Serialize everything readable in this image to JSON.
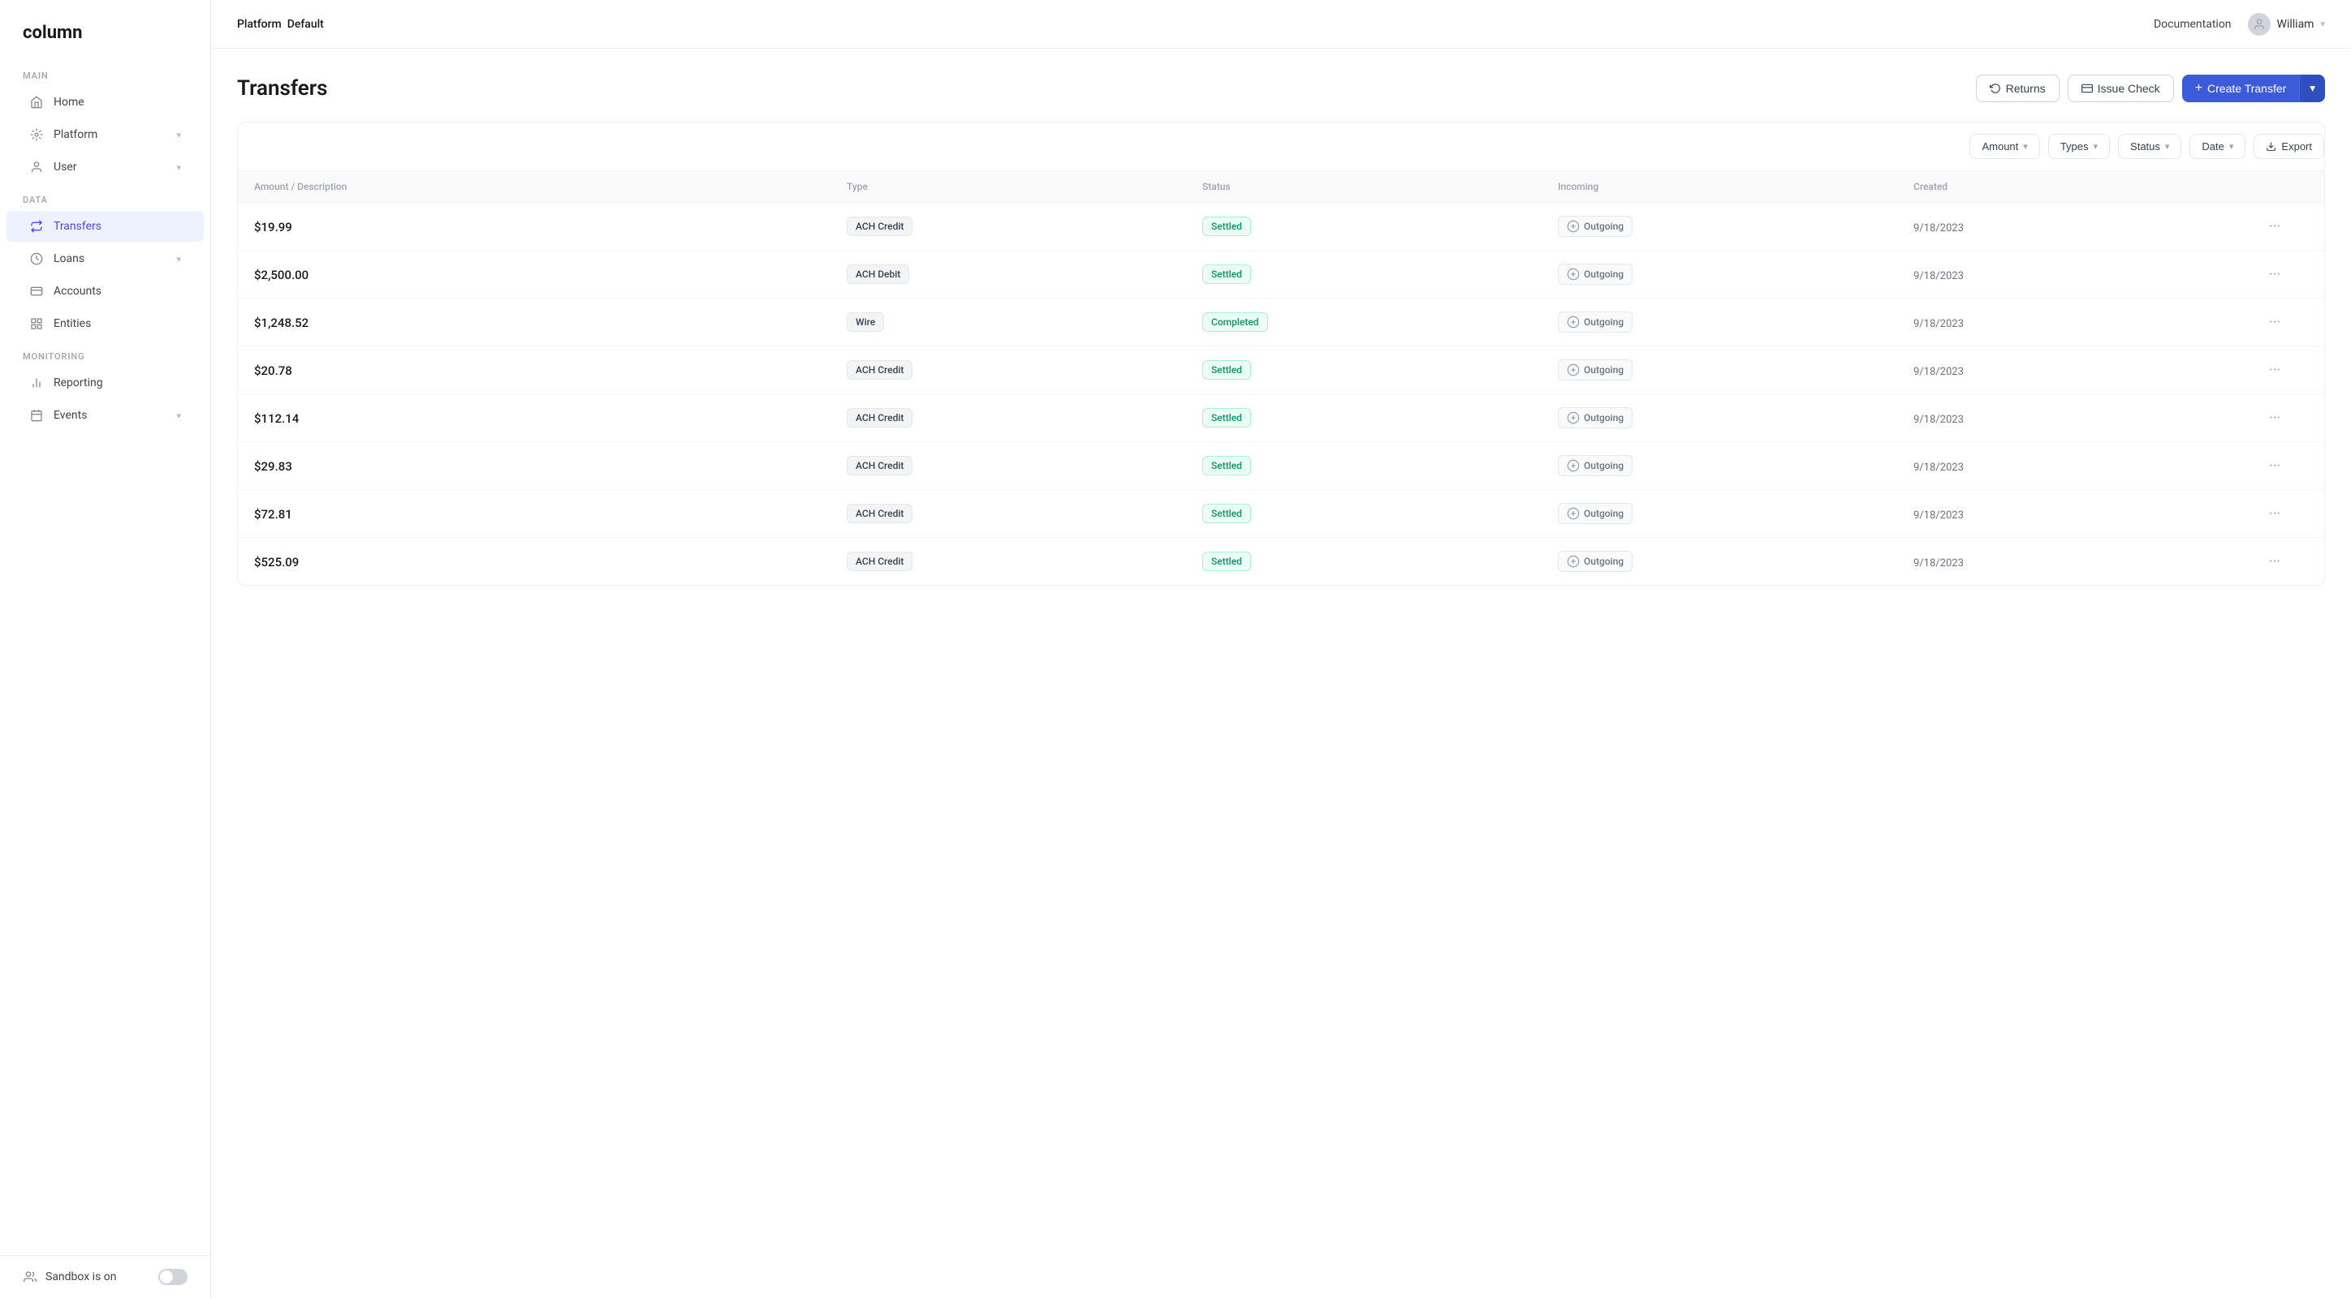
{
  "sidebar": {
    "logo": "column",
    "sections": [
      {
        "label": "MAIN",
        "items": [
          {
            "id": "home",
            "label": "Home",
            "icon": "home",
            "active": false,
            "hasChevron": false
          },
          {
            "id": "platform",
            "label": "Platform",
            "icon": "platform",
            "active": false,
            "hasChevron": true
          },
          {
            "id": "user",
            "label": "User",
            "icon": "user",
            "active": false,
            "hasChevron": true
          }
        ]
      },
      {
        "label": "DATA",
        "items": [
          {
            "id": "transfers",
            "label": "Transfers",
            "icon": "transfers",
            "active": true,
            "hasChevron": false
          },
          {
            "id": "loans",
            "label": "Loans",
            "icon": "loans",
            "active": false,
            "hasChevron": true
          },
          {
            "id": "accounts",
            "label": "Accounts",
            "icon": "accounts",
            "active": false,
            "hasChevron": false
          },
          {
            "id": "entities",
            "label": "Entities",
            "icon": "entities",
            "active": false,
            "hasChevron": false
          }
        ]
      },
      {
        "label": "MONITORING",
        "items": [
          {
            "id": "reporting",
            "label": "Reporting",
            "icon": "reporting",
            "active": false,
            "hasChevron": false
          },
          {
            "id": "events",
            "label": "Events",
            "icon": "events",
            "active": false,
            "hasChevron": true
          }
        ]
      }
    ],
    "sandbox_label": "Sandbox is on"
  },
  "topbar": {
    "platform_label": "Platform",
    "platform_value": "Default",
    "docs_label": "Documentation",
    "user_name": "William"
  },
  "page": {
    "title": "Transfers",
    "returns_btn": "Returns",
    "issue_check_btn": "Issue Check",
    "create_transfer_btn": "+ Create Transfer"
  },
  "filters": {
    "amount_label": "Amount",
    "types_label": "Types",
    "status_label": "Status",
    "date_label": "Date",
    "export_label": "Export"
  },
  "table": {
    "columns": [
      "Amount / Description",
      "Type",
      "Status",
      "Incoming",
      "Created",
      ""
    ],
    "rows": [
      {
        "amount": "$19.99",
        "type": "ACH Credit",
        "status": "Settled",
        "incoming": "Outgoing",
        "created": "9/18/2023"
      },
      {
        "amount": "$2,500.00",
        "type": "ACH Debit",
        "status": "Settled",
        "incoming": "Outgoing",
        "created": "9/18/2023"
      },
      {
        "amount": "$1,248.52",
        "type": "Wire",
        "status": "Completed",
        "incoming": "Outgoing",
        "created": "9/18/2023"
      },
      {
        "amount": "$20.78",
        "type": "ACH Credit",
        "status": "Settled",
        "incoming": "Outgoing",
        "created": "9/18/2023"
      },
      {
        "amount": "$112.14",
        "type": "ACH Credit",
        "status": "Settled",
        "incoming": "Outgoing",
        "created": "9/18/2023"
      },
      {
        "amount": "$29.83",
        "type": "ACH Credit",
        "status": "Settled",
        "incoming": "Outgoing",
        "created": "9/18/2023"
      },
      {
        "amount": "$72.81",
        "type": "ACH Credit",
        "status": "Settled",
        "incoming": "Outgoing",
        "created": "9/18/2023"
      },
      {
        "amount": "$525.09",
        "type": "ACH Credit",
        "status": "Settled",
        "incoming": "Outgoing",
        "created": "9/18/2023"
      }
    ]
  }
}
